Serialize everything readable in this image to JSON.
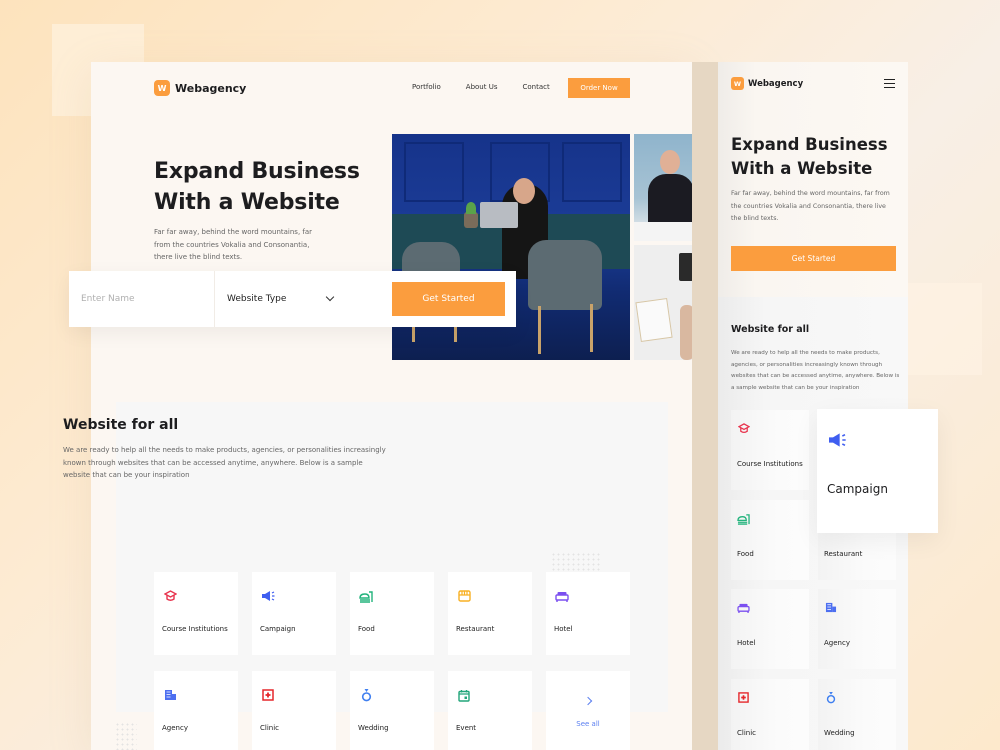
{
  "brand": {
    "name": "Webagency",
    "initial": "W",
    "accent": "#fb9d3e"
  },
  "desktop": {
    "nav": [
      {
        "label": "Portfolio"
      },
      {
        "label": "About Us"
      },
      {
        "label": "Contact"
      }
    ],
    "order_button": "Order Now",
    "hero": {
      "title_line1": "Expand Business",
      "title_line2": "With a Website",
      "description": "Far far away, behind the word mountains, far from the countries Vokalia and Consonantia, there live the blind texts."
    },
    "form": {
      "name_placeholder": "Enter Name",
      "name_value": "",
      "type_selected": "Website Type",
      "submit_label": "Get Started"
    },
    "section": {
      "title": "Website for all",
      "description": "We are ready to help all the needs to make products, agencies, or personalities increasingly known through websites that can be accessed anytime, anywhere. Below is a sample website that can be your inspiration"
    },
    "categories": [
      {
        "label": "Course Institutions",
        "icon": "graduation-cap-icon",
        "color": "#e8344e"
      },
      {
        "label": "Campaign",
        "icon": "megaphone-icon",
        "color": "#3f5ef0"
      },
      {
        "label": "Food",
        "icon": "food-tray-icon",
        "color": "#22b37c"
      },
      {
        "label": "Restaurant",
        "icon": "storefront-icon",
        "color": "#f8b023"
      },
      {
        "label": "Hotel",
        "icon": "bed-icon",
        "color": "#7b4ff0"
      },
      {
        "label": "Agency",
        "icon": "building-icon",
        "color": "#4d6ff0"
      },
      {
        "label": "Clinic",
        "icon": "first-aid-icon",
        "color": "#e5262a"
      },
      {
        "label": "Wedding",
        "icon": "ring-icon",
        "color": "#3f7ff0"
      },
      {
        "label": "Event",
        "icon": "calendar-icon",
        "color": "#22a57a"
      }
    ],
    "see_all": {
      "label": "See all",
      "icon": "chevron-right-icon",
      "color": "#5b7ff0"
    }
  },
  "mobile": {
    "menu_icon": "hamburger-icon",
    "hero": {
      "title_line1": "Expand Business",
      "title_line2": "With a Website",
      "description": "Far far away, behind the word mountains, far from the countries Vokalia and Consonantia, there live the blind texts.",
      "button": "Get Started"
    },
    "section": {
      "title": "Website for all",
      "description": "We are ready to help all the needs to make products, agencies, or personalities increasingly known through websites that can be accessed anytime, anywhere. Below is a sample website that can be your inspiration"
    },
    "categories": [
      {
        "label": "Course Institutions"
      },
      {
        "label": "Food"
      },
      {
        "label": "Restaurant"
      },
      {
        "label": "Hotel"
      },
      {
        "label": "Agency"
      },
      {
        "label": "Clinic"
      },
      {
        "label": "Wedding"
      }
    ],
    "highlight_card": {
      "label": "Campaign"
    }
  }
}
